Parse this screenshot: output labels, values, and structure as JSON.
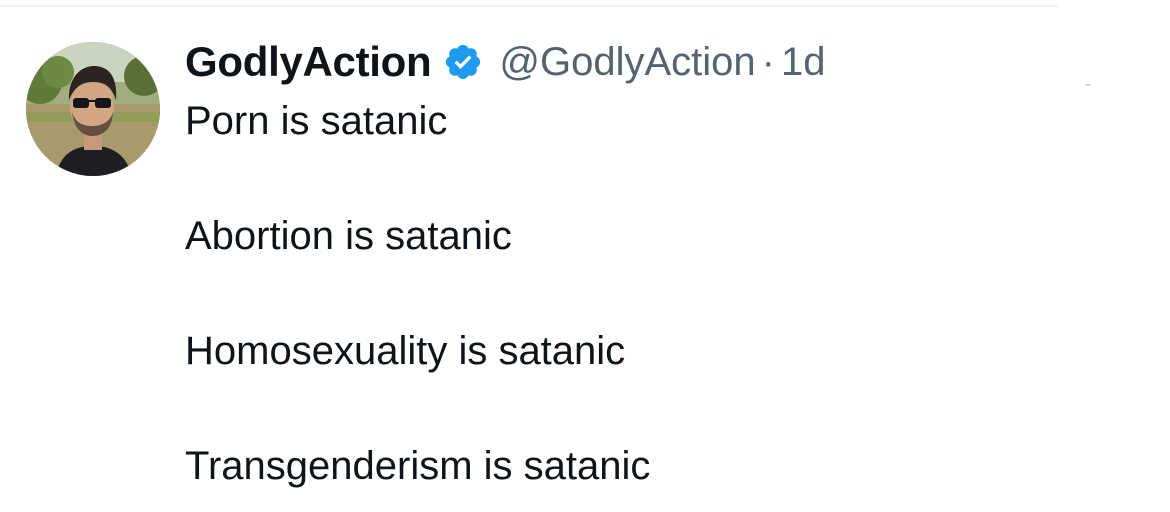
{
  "tweet": {
    "author": {
      "display_name": "GodlyAction",
      "handle": "@GodlyAction",
      "verified": true,
      "verified_icon": "verified-badge-icon",
      "avatar": "profile-photo"
    },
    "separator": "·",
    "timestamp": "1d",
    "lines": [
      "Porn is satanic",
      "Abortion is satanic",
      "Homosexuality is satanic",
      "Transgenderism is satanic"
    ]
  },
  "colors": {
    "text_primary": "#0f1419",
    "text_secondary": "#536471",
    "verified_blue": "#1d9bf0",
    "divider": "#eff3f4"
  }
}
